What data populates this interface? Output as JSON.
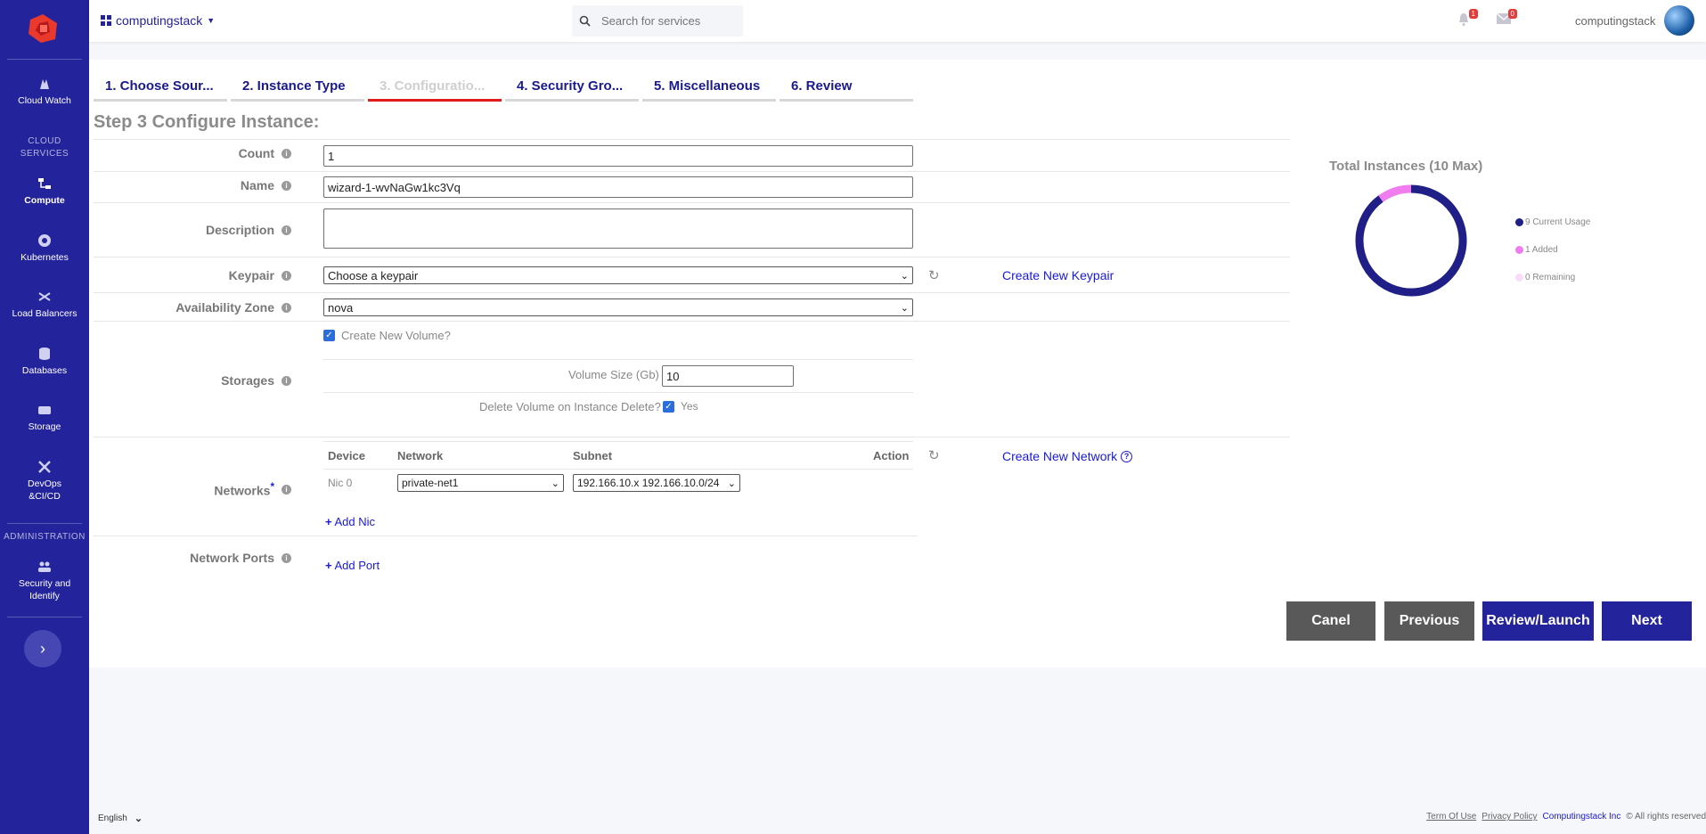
{
  "sidebar": {
    "items": [
      {
        "label": "Cloud Watch",
        "icon": "cloud-watch-icon"
      },
      {
        "label": "Compute",
        "icon": "compute-icon",
        "active": true
      },
      {
        "label": "Kubernetes",
        "icon": "kubernetes-icon"
      },
      {
        "label": "Load Balancers",
        "icon": "load-balancer-icon"
      },
      {
        "label": "Databases",
        "icon": "database-icon"
      },
      {
        "label": "Storage",
        "icon": "storage-icon"
      },
      {
        "label": "DevOps &CI/CD",
        "icon": "devops-icon"
      },
      {
        "label": "Security and Identify",
        "icon": "security-icon"
      }
    ],
    "section_cloud_1": "CLOUD",
    "section_cloud_2": "SERVICES",
    "section_admin": "ADMINISTRATION",
    "expand_icon": "›"
  },
  "topbar": {
    "project": "computingstack",
    "search_placeholder": "Search for services",
    "notifications_count": "1",
    "messages_count": "0",
    "username": "computingstack"
  },
  "tabs": [
    "1. Choose Sour...",
    "2. Instance Type",
    "3. Configuratio...",
    "4. Security Gro...",
    "5. Miscellaneous",
    "6. Review"
  ],
  "active_tab": 2,
  "step_title": "Step 3 Configure Instance:",
  "form": {
    "count_label": "Count",
    "count_value": "1",
    "name_label": "Name",
    "name_value": "wizard-1-wvNaGw1kc3Vq",
    "description_label": "Description",
    "description_value": "",
    "keypair_label": "Keypair",
    "keypair_value": "Choose a keypair",
    "create_keypair": "Create New Keypair",
    "az_label": "Availability Zone",
    "az_value": "nova",
    "storages_label": "Storages",
    "create_volume_label": "Create New Volume?",
    "volume_size_label": "Volume Size (Gb)",
    "volume_size_value": "10",
    "delete_volume_label": "Delete Volume on Instance Delete?",
    "delete_volume_yes": "Yes",
    "networks_label": "Networks",
    "networks_required": "*",
    "net_headers": {
      "device": "Device",
      "network": "Network",
      "subnet": "Subnet",
      "action": "Action"
    },
    "nic_device": "Nic 0",
    "nic_network": "private-net1",
    "nic_subnet": "192.166.10.x 192.166.10.0/24",
    "create_network": "Create New Network",
    "add_nic": "Add Nic",
    "ports_label": "Network Ports",
    "add_port": "Add Port"
  },
  "buttons": {
    "cancel": "Canel",
    "previous": "Previous",
    "review": "Review/Launch",
    "next": "Next"
  },
  "colors": {
    "sidebar": "#23239b",
    "primary": "#23239b",
    "secondary_button": "#595959",
    "link": "#1a1ad8",
    "active_tab_underline": "#e31b1b"
  },
  "chart_data": {
    "type": "pie",
    "title": "Total Instances (10 Max)",
    "categories": [
      "Current Usage",
      "Added",
      "Remaining"
    ],
    "values": [
      9,
      1,
      0
    ],
    "colors": [
      "#1f1f87",
      "#f07cf0",
      "#f9dcf9"
    ],
    "legend_labels": [
      "9 Current Usage",
      "1 Added",
      "0 Remaining"
    ],
    "legend_position": "right"
  },
  "footer": {
    "language": "English",
    "terms": "Term Of Use",
    "privacy": "Privacy Policy",
    "company": "Computingstack Inc",
    "copyright": "© All rights reserved"
  }
}
